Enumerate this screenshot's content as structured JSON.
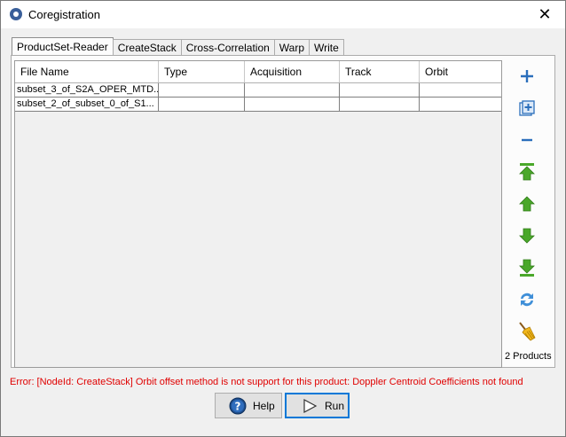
{
  "window": {
    "title": "Coregistration",
    "close_glyph": "✕"
  },
  "tabs": [
    {
      "label": "ProductSet-Reader",
      "active": true
    },
    {
      "label": "CreateStack",
      "active": false
    },
    {
      "label": "Cross-Correlation",
      "active": false
    },
    {
      "label": "Warp",
      "active": false
    },
    {
      "label": "Write",
      "active": false
    }
  ],
  "table": {
    "columns": [
      "File Name",
      "Type",
      "Acquisition",
      "Track",
      "Orbit"
    ],
    "rows": [
      [
        "subset_3_of_S2A_OPER_MTD...",
        "",
        "",
        "",
        ""
      ],
      [
        "subset_2_of_subset_0_of_S1...",
        "",
        "",
        "",
        ""
      ]
    ]
  },
  "side_buttons": [
    "add-icon",
    "add-opened-icon",
    "remove-icon",
    "move-top-icon",
    "move-up-icon",
    "move-down-icon",
    "move-bottom-icon",
    "refresh-icon",
    "clear-icon"
  ],
  "product_count": "2 Products",
  "error_message": "Error: [NodeId: CreateStack] Orbit offset method is not support for this product: Doppler Centroid Coefficients not found",
  "buttons": {
    "help": "Help",
    "run": "Run"
  },
  "colors": {
    "error": "#e00000",
    "accent_blue": "#2a6ebb",
    "arrow_green": "#4aa82a"
  }
}
